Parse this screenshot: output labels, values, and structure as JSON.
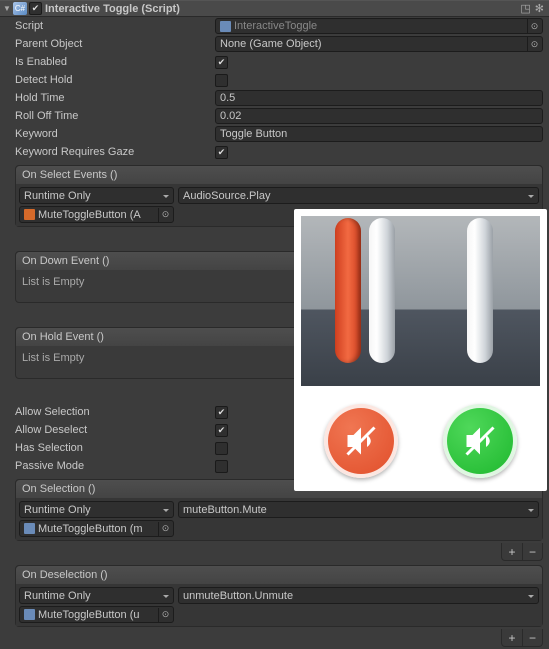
{
  "header": {
    "title": "Interactive Toggle (Script)"
  },
  "fields": {
    "script": {
      "label": "Script",
      "value": "InteractiveToggle"
    },
    "parent": {
      "label": "Parent Object",
      "value": "None (Game Object)"
    },
    "enabled": {
      "label": "Is Enabled",
      "checked": true
    },
    "detectHold": {
      "label": "Detect Hold",
      "checked": false
    },
    "holdTime": {
      "label": "Hold Time",
      "value": "0.5"
    },
    "rollOff": {
      "label": "Roll Off Time",
      "value": "0.02"
    },
    "keyword": {
      "label": "Keyword",
      "value": "Toggle Button"
    },
    "keywordGaze": {
      "label": "Keyword Requires Gaze",
      "checked": true
    },
    "allowSelection": {
      "label": "Allow Selection",
      "checked": true
    },
    "allowDeselect": {
      "label": "Allow Deselect",
      "checked": true
    },
    "hasSelection": {
      "label": "Has Selection",
      "checked": false
    },
    "passiveMode": {
      "label": "Passive Mode",
      "checked": false
    }
  },
  "events": {
    "onSelect": {
      "title": "On Select Events ()",
      "runtime": "Runtime Only",
      "func": "AudioSource.Play",
      "target": "MuteToggleButton (A"
    },
    "onDown": {
      "title": "On Down Event ()",
      "empty": "List is Empty"
    },
    "onHold": {
      "title": "On Hold Event ()",
      "empty": "List is Empty"
    },
    "onSelection": {
      "title": "On Selection ()",
      "runtime": "Runtime Only",
      "func": "muteButton.Mute",
      "target": "MuteToggleButton (m"
    },
    "onDeselection": {
      "title": "On Deselection ()",
      "runtime": "Runtime Only",
      "func": "unmuteButton.Unmute",
      "target": "MuteToggleButton (u"
    }
  },
  "buttons": {
    "plus": "+",
    "minus": "−"
  }
}
